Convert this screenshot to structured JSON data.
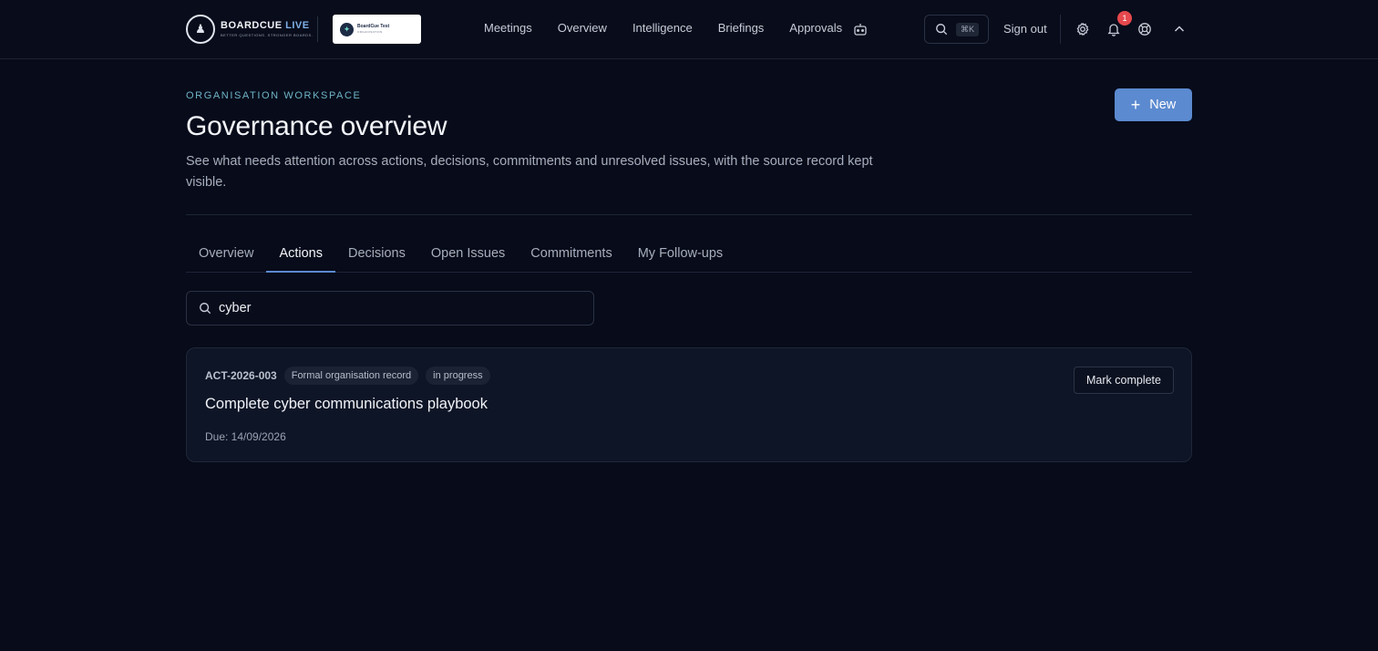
{
  "header": {
    "logo_main": "BOARDCUE",
    "logo_accent": "LIVE",
    "logo_tagline": "BETTER QUESTIONS. STRONGER BOARDS.",
    "org_name": "BoardCue Test",
    "org_sub": "ORGANISATION",
    "nav": [
      {
        "label": "Meetings"
      },
      {
        "label": "Overview"
      },
      {
        "label": "Intelligence"
      },
      {
        "label": "Briefings"
      },
      {
        "label": "Approvals"
      }
    ],
    "search_shortcut": "⌘K",
    "signout_label": "Sign out",
    "notification_count": "1"
  },
  "page": {
    "eyebrow": "ORGANISATION WORKSPACE",
    "title": "Governance overview",
    "description": "See what needs attention across actions, decisions, commitments and unresolved issues, with the source record kept visible.",
    "new_label": "New"
  },
  "tabs": [
    {
      "label": "Overview",
      "active": false
    },
    {
      "label": "Actions",
      "active": true
    },
    {
      "label": "Decisions",
      "active": false
    },
    {
      "label": "Open Issues",
      "active": false
    },
    {
      "label": "Commitments",
      "active": false
    },
    {
      "label": "My Follow-ups",
      "active": false
    }
  ],
  "filter": {
    "value": "cyber"
  },
  "actions": [
    {
      "ref": "ACT-2026-003",
      "record_type": "Formal organisation record",
      "status": "in progress",
      "title": "Complete cyber communications playbook",
      "due": "Due: 14/09/2026",
      "action_label": "Mark complete"
    }
  ],
  "colors": {
    "background": "#070b1a",
    "accent": "#5b8ad0",
    "eyebrow": "#6fb4c7",
    "badge": "#e5484d"
  }
}
